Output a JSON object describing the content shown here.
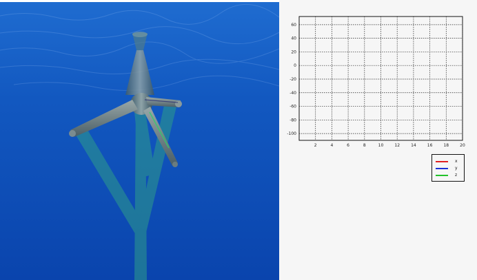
{
  "scene": {
    "description_icon": "tidal-turbine-3d-view",
    "water_color_top": "#1d66c9",
    "water_color_bottom": "#0a3fa8"
  },
  "chart_data": {
    "type": "line",
    "title": "",
    "xlabel": "",
    "ylabel": "",
    "xlim": [
      0,
      20
    ],
    "ylim": [
      -110,
      72
    ],
    "x_ticks": [
      2,
      4,
      6,
      8,
      10,
      12,
      14,
      16,
      18,
      20
    ],
    "y_ticks": [
      60,
      40,
      20,
      0,
      -20,
      -40,
      -60,
      -80,
      -100
    ],
    "grid": true,
    "grid_style": "dotted",
    "legend_position": "bottom-right, outside plot",
    "series": [
      {
        "name": "x",
        "color": "#e02020",
        "values": []
      },
      {
        "name": "y",
        "color": "#1a2fd6",
        "values": []
      },
      {
        "name": "z",
        "color": "#22c22a",
        "values": []
      }
    ]
  },
  "legend": {
    "items": [
      {
        "label": "x",
        "color": "#e02020"
      },
      {
        "label": "y",
        "color": "#1a2fd6"
      },
      {
        "label": "z",
        "color": "#22c22a"
      }
    ]
  }
}
